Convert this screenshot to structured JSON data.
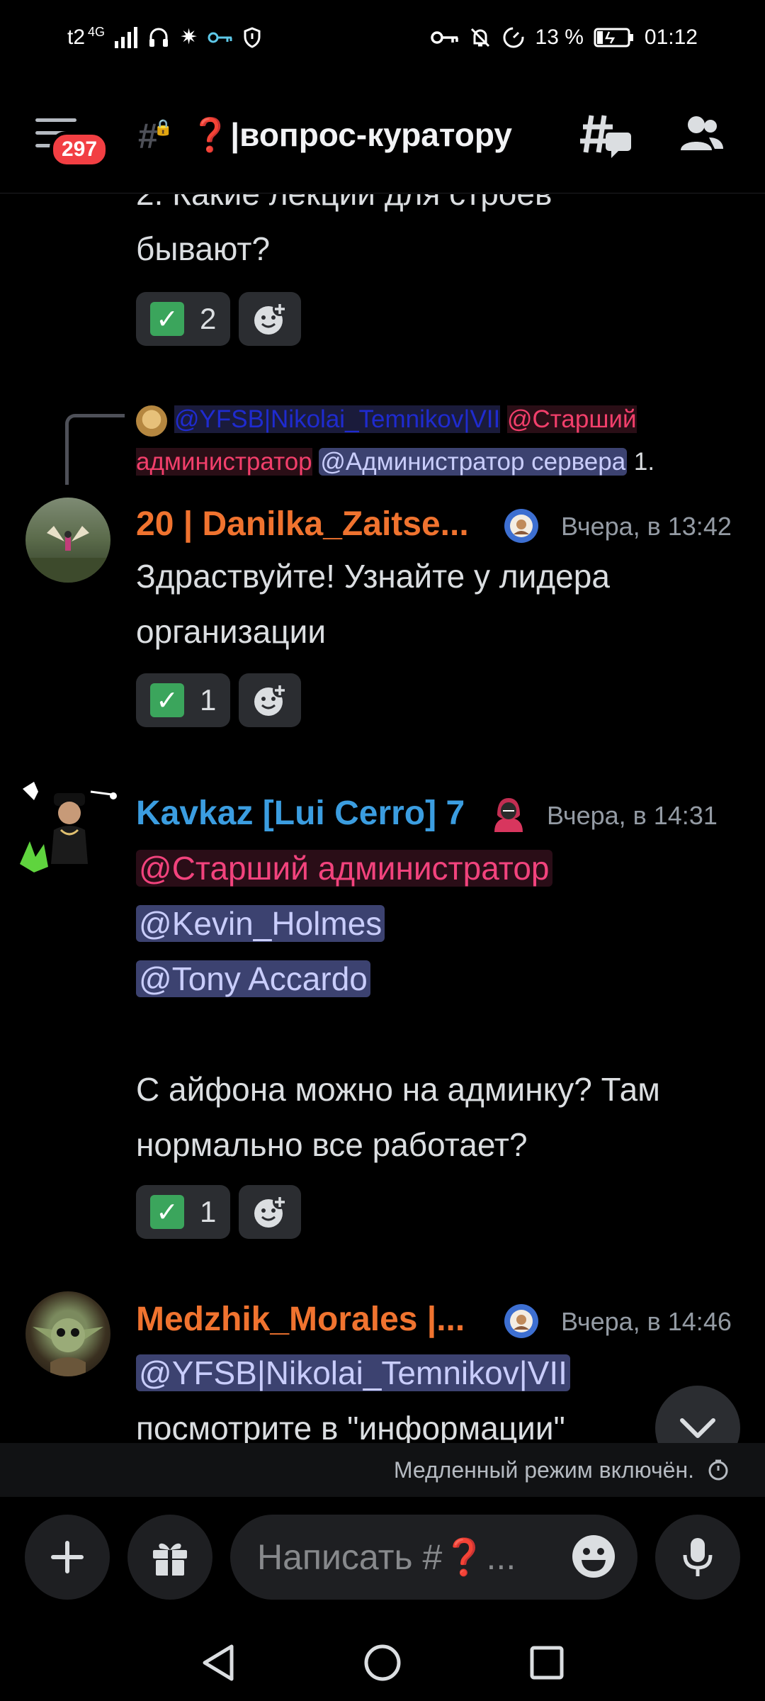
{
  "status_bar": {
    "carrier": "t2",
    "network": "4G",
    "battery": "13 %",
    "time": "01:12"
  },
  "header": {
    "unread_badge": "297",
    "channel_name": "❓|вопрос-куратору"
  },
  "messages": [
    {
      "partial_text_line1": "2.  Какие лекции для строев",
      "partial_text_line2": "бывают?",
      "reaction_count": "2"
    },
    {
      "reply": {
        "mention_1": "@YFSB|Nikolai_Temnikov|VII",
        "mention_2": "@Старший",
        "mention_2b": "администратор",
        "mention_3": "@Администратор сервера",
        "tail": " 1."
      },
      "username": "20 | Danilka_Zaitse...",
      "timestamp": "Вчера, в 13:42",
      "text_line1": "Здраствуйте! Узнайте у лидера",
      "text_line2": "организации",
      "reaction_count": "1",
      "username_color": "#f0732f"
    },
    {
      "username": "Kavkaz [Lui Cerro] 7",
      "timestamp": "Вчера, в 14:31",
      "mention_1": "@Старший администратор",
      "mention_2": "@Kevin_Holmes",
      "mention_3": "@Tony Accardo",
      "text_line1": "С айфона можно на админку? Там",
      "text_line2": "нормально все работает?",
      "reaction_count": "1",
      "username_color": "#3b9de0"
    },
    {
      "username": "Medzhik_Morales |...",
      "timestamp": "Вчера, в 14:46",
      "mention_1": "@YFSB|Nikolai_Temnikov|VII",
      "text_line1": "посмотрите в \"информации\"",
      "username_color": "#f0732f"
    }
  ],
  "slowmode_text": "Медленный режим включён.",
  "composer": {
    "placeholder": "Написать #❓..."
  },
  "icons": {
    "menu": "hamburger-icon",
    "threads": "threads-icon",
    "members": "members-icon",
    "add": "plus-icon",
    "gift": "gift-icon",
    "emoji": "emoji-icon",
    "mic": "microphone-icon"
  }
}
